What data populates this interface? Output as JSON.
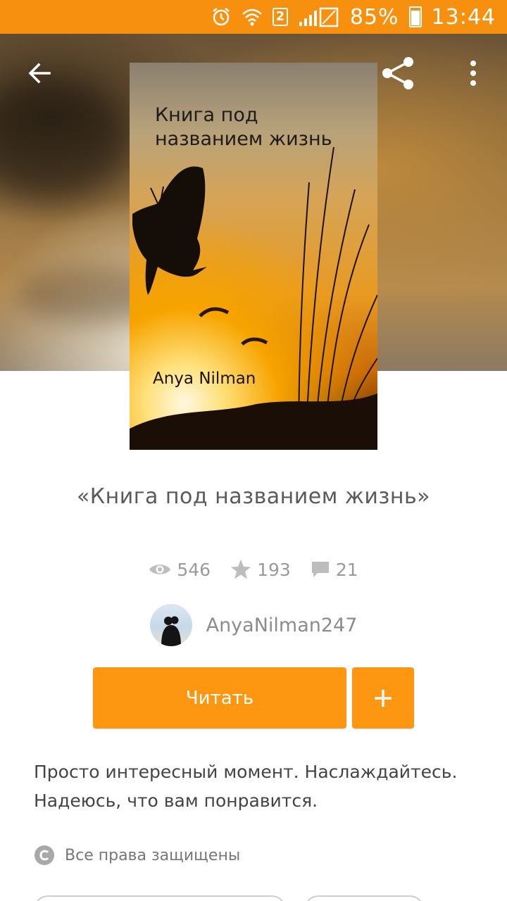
{
  "status_bar": {
    "battery": "85%",
    "time": "13:44",
    "sim_slot": "2",
    "icons": [
      "alarm-icon",
      "wifi-icon",
      "sim-icon",
      "signal-icon",
      "battery-icon"
    ]
  },
  "toolbar": {
    "back_icon": "arrow-left-icon",
    "share_icon": "share-icon",
    "more_icon": "more-vertical-icon"
  },
  "cover": {
    "title": "Книга под названием жизнь",
    "author": "Anya Nilman"
  },
  "book": {
    "title": "«Книга под названием жизнь»",
    "views": "546",
    "stars": "193",
    "comments": "21"
  },
  "author": {
    "username": "AnyaNilman247"
  },
  "actions": {
    "read_label": "Читать",
    "add_icon": "plus-icon"
  },
  "description": "Просто интересный момент. Наслаждайтесь. Надеюсь, что вам понравится.",
  "copyright": {
    "label": "Все права защищены",
    "icon": "copyright-icon"
  },
  "colors": {
    "accent": "#fd9711",
    "status_bar": "#f7900f",
    "muted_text": "#9a9a9a"
  }
}
